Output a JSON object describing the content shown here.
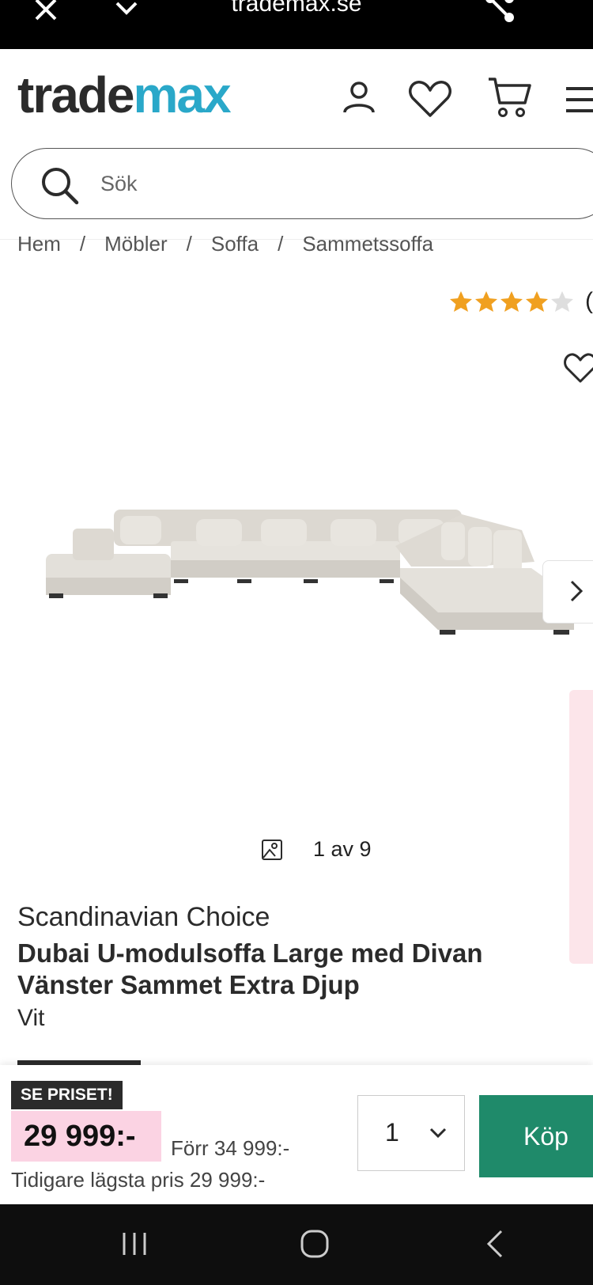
{
  "browser": {
    "url": "trademax.se"
  },
  "header": {
    "logo_part1": "trade",
    "logo_part2": "max",
    "brand_color": "#2aa8c9",
    "icons": [
      "user-icon",
      "heart-icon",
      "cart-icon",
      "menu-icon"
    ]
  },
  "search": {
    "placeholder": "Sök"
  },
  "breadcrumbs": [
    "Hem",
    "Möbler",
    "Soffa",
    "Sammetssoffa"
  ],
  "rating": {
    "value": 4,
    "max": 5,
    "paren": "("
  },
  "gallery": {
    "counter": "1 av 9"
  },
  "product": {
    "brand": "Scandinavian Choice",
    "title": "Dubai U-modulsoffa Large med Divan Vänster Sammet Extra Djup",
    "variant": "Vit"
  },
  "buybar": {
    "badge": "SE PRISET!",
    "price": "29 999:-",
    "was": "Förr 34 999:-",
    "lowest": "Tidigare lägsta pris 29 999:-",
    "quantity": "1",
    "buy_label": "Köp",
    "buy_color": "#1f8a6a",
    "price_bg": "#fbd3e3"
  }
}
